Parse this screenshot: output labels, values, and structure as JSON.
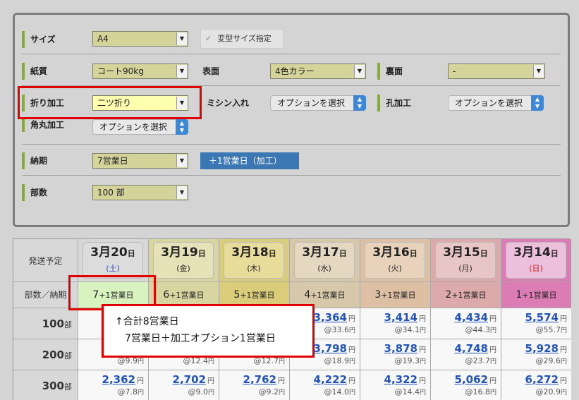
{
  "options": {
    "size": {
      "label": "サイズ",
      "value": "A4",
      "custom_label": "変型サイズ指定"
    },
    "paper": {
      "label": "紙質",
      "value": "コート90kg"
    },
    "front": {
      "label": "表面",
      "value": "4色カラー"
    },
    "back": {
      "label": "裏面",
      "value": "-"
    },
    "fold": {
      "label": "折り加工",
      "value": "二ツ折り"
    },
    "perforation": {
      "label": "ミシン入れ",
      "value": "オプションを選択"
    },
    "hole": {
      "label": "孔加工",
      "value": "オプションを選択"
    },
    "corner": {
      "label": "角丸加工",
      "value": "オプションを選択"
    },
    "delivery": {
      "label": "納期",
      "value": "7営業日",
      "extra_button": "＋1営業日（加工）"
    },
    "quantity": {
      "label": "部数",
      "value": "100 部"
    }
  },
  "table": {
    "ship_label": "発送予定",
    "qty_delivery_label": "部数／納期",
    "columns": [
      {
        "month": "3月",
        "day": "20",
        "suffix": "日",
        "weekday": "(土)",
        "delivery": "7",
        "plus": "+1営業日",
        "card_bg": "#dcdcdc",
        "col_bg": "#d8d8d8",
        "wd_color": "#2f4fc0"
      },
      {
        "month": "3月",
        "day": "19",
        "suffix": "日",
        "weekday": "(金)",
        "delivery": "6",
        "plus": "+1営業日",
        "card_bg": "#e6e2b8",
        "col_bg": "#d9d5a0",
        "wd_color": "#222222"
      },
      {
        "month": "3月",
        "day": "18",
        "suffix": "日",
        "weekday": "(木)",
        "delivery": "5",
        "plus": "+1営業日",
        "card_bg": "#e8dc9a",
        "col_bg": "#d9cd7a",
        "wd_color": "#222222"
      },
      {
        "month": "3月",
        "day": "17",
        "suffix": "日",
        "weekday": "(水)",
        "delivery": "4",
        "plus": "+1営業日",
        "card_bg": "#e4d8c0",
        "col_bg": "#d6c8a8",
        "wd_color": "#222222"
      },
      {
        "month": "3月",
        "day": "16",
        "suffix": "日",
        "weekday": "(火)",
        "delivery": "3",
        "plus": "+1営業日",
        "card_bg": "#e8d2bc",
        "col_bg": "#ddc0a4",
        "wd_color": "#222222"
      },
      {
        "month": "3月",
        "day": "15",
        "suffix": "日",
        "weekday": "(月)",
        "delivery": "2",
        "plus": "+1営業日",
        "card_bg": "#e8c6c6",
        "col_bg": "#dcaaaa",
        "wd_color": "#222222"
      },
      {
        "month": "3月",
        "day": "14",
        "suffix": "日",
        "weekday": "(日)",
        "delivery": "1",
        "plus": "+1営業日",
        "card_bg": "#ecc0dc",
        "col_bg": "#dc7cb4",
        "wd_color": "#d02020"
      }
    ],
    "rows": [
      {
        "qty": "100",
        "unit": "部",
        "cells": [
          {
            "price": "",
            "per": ""
          },
          {
            "price": "",
            "per": ""
          },
          {
            "price": "",
            "per": ""
          },
          {
            "price": "3,364",
            "per": "@33.6"
          },
          {
            "price": "3,414",
            "per": "@34.1"
          },
          {
            "price": "4,434",
            "per": "@44.3"
          },
          {
            "price": "5,574",
            "per": "@55.7"
          }
        ]
      },
      {
        "qty": "200",
        "unit": "部",
        "cells": [
          {
            "price": "",
            "per": "@9.9"
          },
          {
            "price": "",
            "per": "@12.4"
          },
          {
            "price": "",
            "per": "@12.7"
          },
          {
            "price": "3,798",
            "per": "@18.9"
          },
          {
            "price": "3,878",
            "per": "@19.3"
          },
          {
            "price": "4,748",
            "per": "@23.7"
          },
          {
            "price": "5,928",
            "per": "@29.6"
          }
        ]
      },
      {
        "qty": "300",
        "unit": "部",
        "cells": [
          {
            "price": "2,362",
            "per": "@7.8"
          },
          {
            "price": "2,702",
            "per": "@9.0"
          },
          {
            "price": "2,762",
            "per": "@9.2"
          },
          {
            "price": "4,222",
            "per": "@14.0"
          },
          {
            "price": "4,322",
            "per": "@14.4"
          },
          {
            "price": "5,062",
            "per": "@16.8"
          },
          {
            "price": "6,272",
            "per": "@20.9"
          }
        ]
      }
    ],
    "currency": "円"
  },
  "callout": {
    "line1": "↑合計8営業日",
    "line2": "7営業日＋加工オプション1営業日"
  },
  "icons": {
    "check": "check-icon",
    "dropdown": "chevron-down-icon",
    "spinner": "up-down-icon"
  },
  "colors": {
    "highlight": "#e00000",
    "label_bar": "#86ab3b",
    "price_link": "#2253b8",
    "option_spin": "#3d87d6"
  }
}
